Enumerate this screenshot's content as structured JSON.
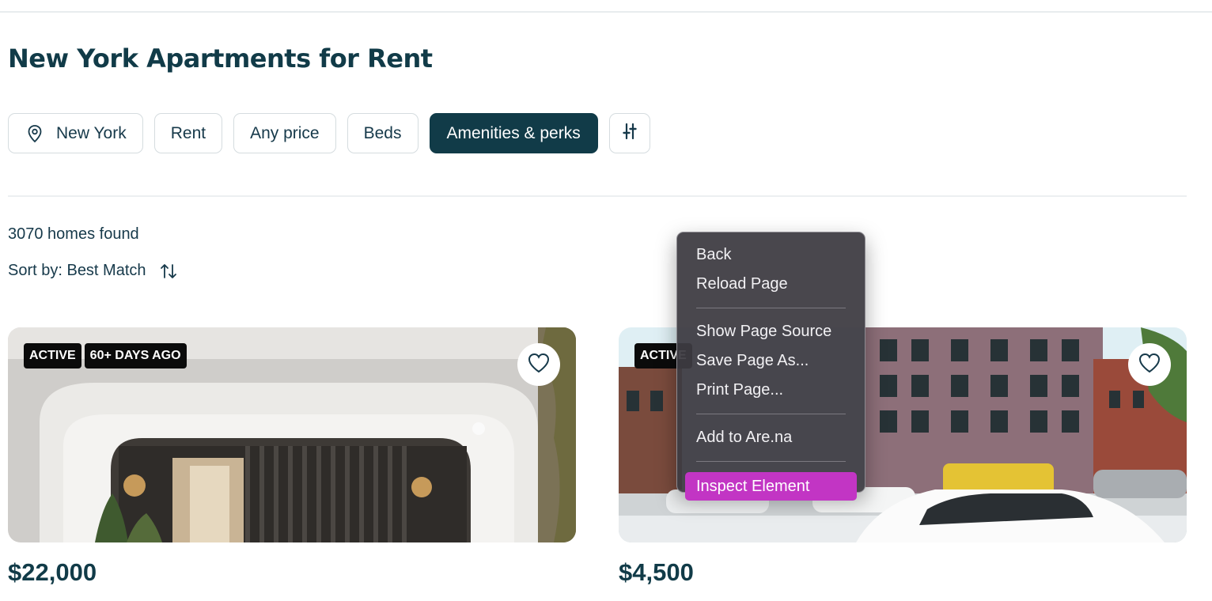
{
  "page": {
    "title": "New York Apartments for Rent"
  },
  "filters": {
    "location": "New York",
    "listing_type": "Rent",
    "price": "Any price",
    "beds": "Beds",
    "amenities": "Amenities & perks",
    "more_filters_icon": "sliders-icon"
  },
  "results": {
    "count_text": "3070 homes found",
    "sort_text": "Sort by: Best Match",
    "sort_icon": "sort-arrows-icon"
  },
  "listings": [
    {
      "badges": [
        "ACTIVE",
        "60+ DAYS AGO"
      ],
      "price": "$22,000",
      "favorite_icon": "heart-icon"
    },
    {
      "badges": [
        "ACTIVE"
      ],
      "price": "$4,500",
      "favorite_icon": "heart-icon"
    }
  ],
  "context_menu": {
    "groups": [
      [
        "Back",
        "Reload Page"
      ],
      [
        "Show Page Source",
        "Save Page As...",
        "Print Page..."
      ],
      [
        "Add to Are.na"
      ],
      [
        "Inspect Element"
      ]
    ],
    "highlighted": "Inspect Element",
    "highlight_color": "#c235c4"
  },
  "colors": {
    "brand": "#113b48",
    "chip_border": "#d5dcdf",
    "badge_bg": "#0b0b0b"
  }
}
